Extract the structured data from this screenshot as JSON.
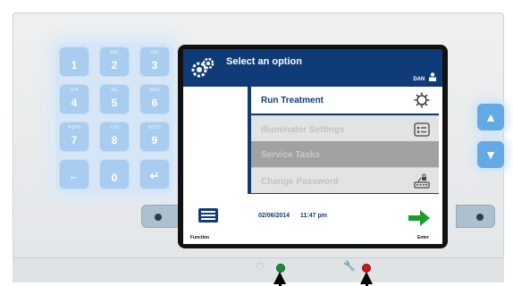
{
  "screen": {
    "title": "Select an option",
    "user": "DAN",
    "menu": [
      {
        "label": "Run Treatment",
        "state": "active",
        "icon": "sun-icon"
      },
      {
        "label": "Illuminator Settings",
        "state": "disabled",
        "icon": "settings-list-icon"
      },
      {
        "label": "Service Tasks",
        "state": "selected",
        "icon": ""
      },
      {
        "label": "Change Password",
        "state": "disabled",
        "icon": "password-keyboard-icon"
      }
    ],
    "footer": {
      "function_label": "Function",
      "date": "02/06/2014",
      "time": "11:47 pm",
      "enter_label": "Enter"
    }
  },
  "keypad": {
    "keys": [
      {
        "num": "1",
        "sub": ""
      },
      {
        "num": "2",
        "sub": "ABC"
      },
      {
        "num": "3",
        "sub": "DEF"
      },
      {
        "num": "4",
        "sub": "GHI"
      },
      {
        "num": "5",
        "sub": "JKL"
      },
      {
        "num": "6",
        "sub": "MNO"
      },
      {
        "num": "7",
        "sub": "PQRS"
      },
      {
        "num": "8",
        "sub": "TUV"
      },
      {
        "num": "9",
        "sub": "WXYZ"
      },
      {
        "num": "0",
        "sub": ""
      }
    ],
    "backspace_symbol": "←",
    "enter_symbol": "↵"
  },
  "side_buttons": {
    "up": "▲",
    "down": "▼"
  },
  "colors": {
    "titlebar": "#0f3b78",
    "keypad_key": "#a9cdf0",
    "side_button": "#63a9e6",
    "power_led": "#1f8a3a",
    "status_led": "#d01616",
    "enter_arrow": "#1a9c2a"
  }
}
